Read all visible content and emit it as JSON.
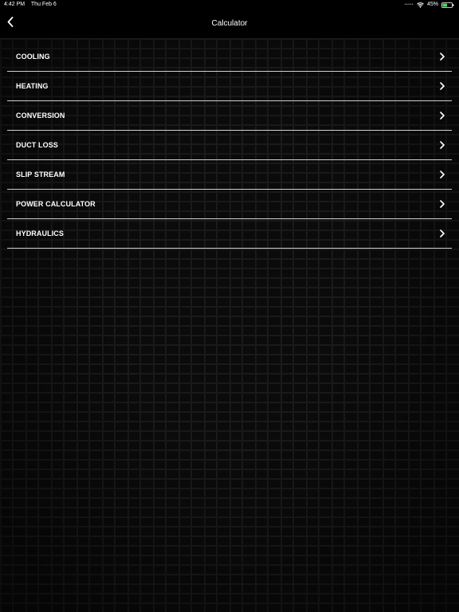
{
  "status_bar": {
    "time": "4:42 PM",
    "date": "Thu Feb 6",
    "battery": "45%"
  },
  "nav": {
    "title": "Calculator",
    "back_icon": "chevron-left-icon"
  },
  "menu": {
    "items": [
      {
        "label": "COOLING"
      },
      {
        "label": "HEATING"
      },
      {
        "label": "CONVERSION"
      },
      {
        "label": "DUCT LOSS"
      },
      {
        "label": "SLIP STREAM"
      },
      {
        "label": "POWER CALCULATOR"
      },
      {
        "label": "HYDRAULICS"
      }
    ],
    "item_icon": "chevron-right-icon",
    "divider_color": "#d0d0d0"
  },
  "colors": {
    "background": "#0b0b0b",
    "text": "#ffffff",
    "battery_fill": "#4cd964"
  }
}
